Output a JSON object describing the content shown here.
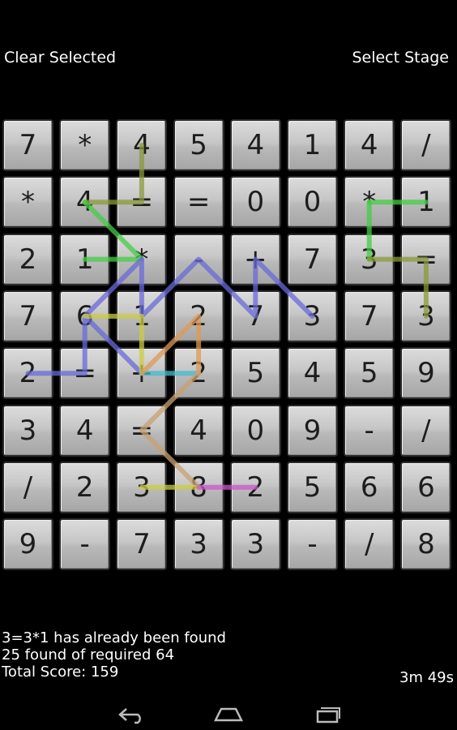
{
  "top": {
    "clear_label": "Clear Selected",
    "stage_label": "Select Stage"
  },
  "grid": [
    [
      "7",
      "*",
      "4",
      "5",
      "4",
      "1",
      "4",
      "/"
    ],
    [
      "*",
      "4",
      "=",
      "=",
      "0",
      "0",
      "*",
      "1"
    ],
    [
      "2",
      "1",
      "*",
      "-",
      "+",
      "7",
      "3",
      "="
    ],
    [
      "7",
      "6",
      "1",
      "2",
      "7",
      "3",
      "7",
      "3"
    ],
    [
      "2",
      "=",
      "+",
      "2",
      "5",
      "4",
      "5",
      "9"
    ],
    [
      "3",
      "4",
      "=",
      "4",
      "0",
      "9",
      "-",
      "/"
    ],
    [
      "/",
      "2",
      "3",
      "8",
      "2",
      "5",
      "6",
      "6"
    ],
    [
      "9",
      "-",
      "7",
      "3",
      "3",
      "-",
      "/",
      "8"
    ]
  ],
  "found_paths": [
    {
      "color": "#8a9a3a",
      "cells": [
        [
          0,
          2
        ],
        [
          1,
          2
        ],
        [
          1,
          1
        ]
      ]
    },
    {
      "color": "#44cc44",
      "cells": [
        [
          1,
          1
        ],
        [
          2,
          2
        ],
        [
          2,
          1
        ]
      ]
    },
    {
      "color": "#44cc44",
      "cells": [
        [
          1,
          6
        ],
        [
          1,
          7
        ]
      ]
    },
    {
      "color": "#44cc44",
      "cells": [
        [
          1,
          6
        ],
        [
          2,
          6
        ]
      ]
    },
    {
      "color": "#8a9a3a",
      "cells": [
        [
          2,
          6
        ],
        [
          2,
          7
        ],
        [
          3,
          7
        ]
      ]
    },
    {
      "color": "#6a6ad8",
      "cells": [
        [
          4,
          0
        ],
        [
          4,
          1
        ],
        [
          3,
          1
        ],
        [
          2,
          2
        ],
        [
          3,
          2
        ],
        [
          2,
          3
        ],
        [
          3,
          4
        ],
        [
          2,
          4
        ],
        [
          3,
          5
        ]
      ]
    },
    {
      "color": "#6a6ad8",
      "cells": [
        [
          3,
          1
        ],
        [
          4,
          2
        ]
      ]
    },
    {
      "color": "#cccc44",
      "cells": [
        [
          3,
          1
        ],
        [
          3,
          2
        ],
        [
          4,
          2
        ]
      ]
    },
    {
      "color": "#44bbcc",
      "cells": [
        [
          4,
          2
        ],
        [
          4,
          3
        ]
      ]
    },
    {
      "color": "#dd9955",
      "cells": [
        [
          4,
          2
        ],
        [
          3,
          3
        ],
        [
          4,
          3
        ]
      ]
    },
    {
      "color": "#c8a070",
      "cells": [
        [
          4,
          3
        ],
        [
          5,
          2
        ],
        [
          6,
          3
        ]
      ]
    },
    {
      "color": "#cccc44",
      "cells": [
        [
          6,
          2
        ],
        [
          6,
          3
        ]
      ]
    },
    {
      "color": "#cc55cc",
      "cells": [
        [
          6,
          3
        ],
        [
          6,
          4
        ]
      ]
    }
  ],
  "status": {
    "message": "3=3*1 has already been found",
    "found": "25 found of required 64",
    "score": "Total Score: 159",
    "timer": "3m 49s"
  },
  "nav": {
    "back_icon": "back-icon",
    "home_icon": "home-icon",
    "recents_icon": "recents-icon"
  }
}
